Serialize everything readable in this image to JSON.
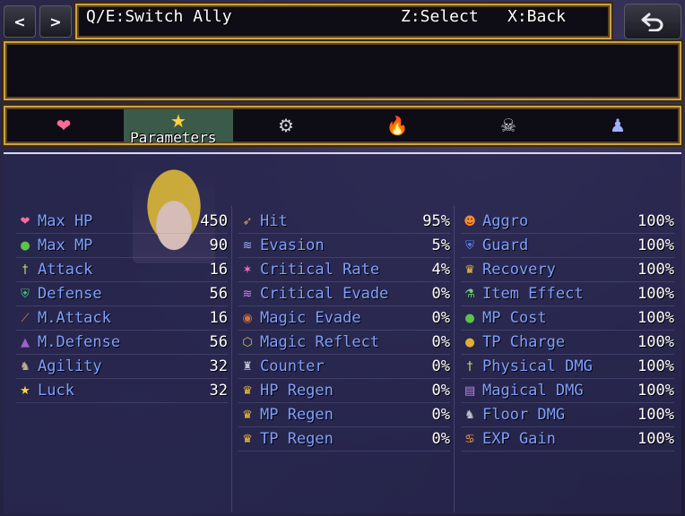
{
  "header": {
    "prev_label": "<",
    "next_label": ">",
    "switch_hint": "Q/E:Switch Ally",
    "select_hint": "Z:Select",
    "back_hint": "X:Back",
    "back_icon": "undo-arrow-icon"
  },
  "tabs": [
    {
      "icon": "heart-icon",
      "glyph": "❤",
      "color": "#ff6b9a"
    },
    {
      "icon": "star-icon",
      "glyph": "★",
      "color": "#ffd23a",
      "label": "Parameters",
      "active": true
    },
    {
      "icon": "gear-icon",
      "glyph": "⚙",
      "color": "#d0d0d8"
    },
    {
      "icon": "fire-icon",
      "glyph": "🔥",
      "color": "#ff8a2a"
    },
    {
      "icon": "skull-icon",
      "glyph": "☠",
      "color": "#d8d8e0"
    },
    {
      "icon": "figures-icon",
      "glyph": "♟",
      "color": "#9fb0ff"
    }
  ],
  "columns": [
    [
      {
        "icon": "heart-icon",
        "glyph": "❤",
        "color": "#ff6b9a",
        "label": "Max HP",
        "value": "450"
      },
      {
        "icon": "green-orb-icon",
        "glyph": "●",
        "color": "#5ac34a",
        "label": "Max MP",
        "value": "90"
      },
      {
        "icon": "sword-icon",
        "glyph": "†",
        "color": "#c8e070",
        "label": "Attack",
        "value": "16"
      },
      {
        "icon": "shield-icon",
        "glyph": "⛨",
        "color": "#4ac080",
        "label": "Defense",
        "value": "56"
      },
      {
        "icon": "staff-icon",
        "glyph": "⟋",
        "color": "#e08a3a",
        "label": "M.Attack",
        "value": "16"
      },
      {
        "icon": "wizard-hat-icon",
        "glyph": "▲",
        "color": "#a060d0",
        "label": "M.Defense",
        "value": "56"
      },
      {
        "icon": "boot-icon",
        "glyph": "♞",
        "color": "#c0b090",
        "label": "Agility",
        "value": "32"
      },
      {
        "icon": "star-icon",
        "glyph": "★",
        "color": "#ffd23a",
        "label": "Luck",
        "value": "32"
      }
    ],
    [
      {
        "icon": "bow-icon",
        "glyph": "➶",
        "color": "#e0a060",
        "label": "Hit",
        "value": "95%"
      },
      {
        "icon": "evasion-icon",
        "glyph": "≋",
        "color": "#9fb0ff",
        "label": "Evasion",
        "value": "5%"
      },
      {
        "icon": "critical-burst-icon",
        "glyph": "✶",
        "color": "#ff70c0",
        "label": "Critical Rate",
        "value": "4%"
      },
      {
        "icon": "critical-evade-icon",
        "glyph": "≋",
        "color": "#d080ff",
        "label": "Critical Evade",
        "value": "0%"
      },
      {
        "icon": "magic-evade-icon",
        "glyph": "◉",
        "color": "#d07040",
        "label": "Magic Evade",
        "value": "0%"
      },
      {
        "icon": "magic-reflect-icon",
        "glyph": "⬡",
        "color": "#e0c060",
        "label": "Magic Reflect",
        "value": "0%"
      },
      {
        "icon": "counter-icon",
        "glyph": "♜",
        "color": "#c0c0d0",
        "label": "Counter",
        "value": "0%"
      },
      {
        "icon": "hp-regen-icon",
        "glyph": "♛",
        "color": "#f0c040",
        "label": "HP Regen",
        "value": "0%"
      },
      {
        "icon": "mp-regen-icon",
        "glyph": "♛",
        "color": "#f0c040",
        "label": "MP Regen",
        "value": "0%"
      },
      {
        "icon": "tp-regen-icon",
        "glyph": "♛",
        "color": "#f0c040",
        "label": "TP Regen",
        "value": "0%"
      }
    ],
    [
      {
        "icon": "aggro-icon",
        "glyph": "☻",
        "color": "#ff8a2a",
        "label": "Aggro",
        "value": "100%"
      },
      {
        "icon": "guard-shield-icon",
        "glyph": "⛨",
        "color": "#5a8aff",
        "label": "Guard",
        "value": "100%"
      },
      {
        "icon": "recovery-icon",
        "glyph": "♛",
        "color": "#f0c040",
        "label": "Recovery",
        "value": "100%"
      },
      {
        "icon": "potion-icon",
        "glyph": "⚗",
        "color": "#70d070",
        "label": "Item Effect",
        "value": "100%"
      },
      {
        "icon": "mp-orb-icon",
        "glyph": "●",
        "color": "#5ac34a",
        "label": "MP Cost",
        "value": "100%"
      },
      {
        "icon": "tp-orb-icon",
        "glyph": "●",
        "color": "#e0b030",
        "label": "TP Charge",
        "value": "100%"
      },
      {
        "icon": "sword-icon",
        "glyph": "†",
        "color": "#c8e070",
        "label": "Physical DMG",
        "value": "100%"
      },
      {
        "icon": "spellbook-icon",
        "glyph": "▤",
        "color": "#c080f0",
        "label": "Magical DMG",
        "value": "100%"
      },
      {
        "icon": "boots-icon",
        "glyph": "♞",
        "color": "#c0c0d0",
        "label": "Floor DMG",
        "value": "100%"
      },
      {
        "icon": "exp-icon",
        "glyph": "♋",
        "color": "#ff9a3a",
        "label": "EXP Gain",
        "value": "100%"
      }
    ]
  ]
}
